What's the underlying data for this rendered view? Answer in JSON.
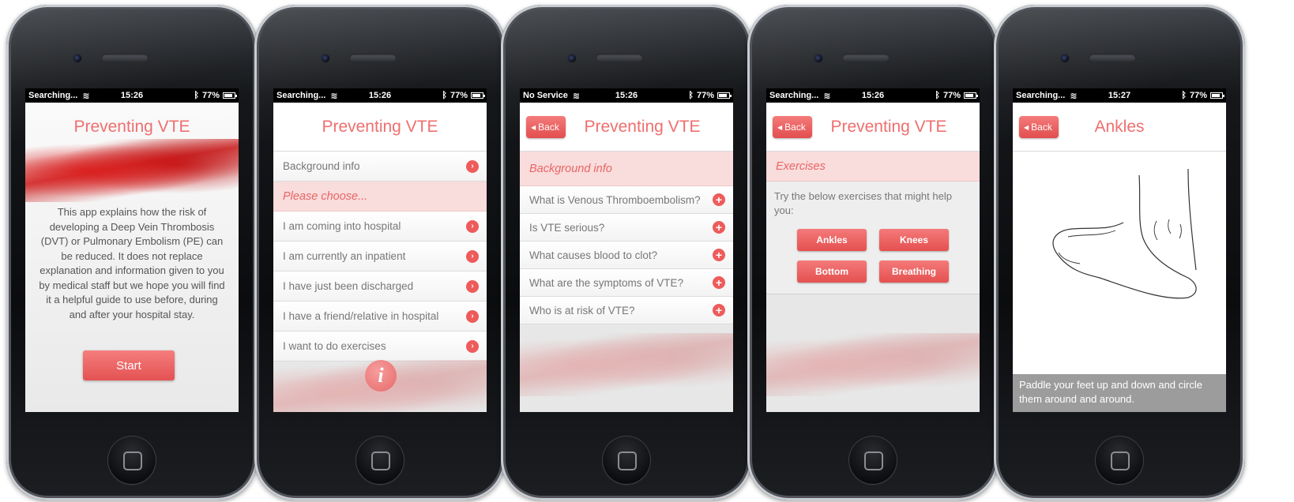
{
  "screens": [
    {
      "status": {
        "carrier": "Searching...",
        "time": "15:26",
        "battery": "77%"
      },
      "title": "Preventing VTE",
      "intro": "This app explains how the risk of developing a Deep Vein Thrombosis (DVT) or Pulmonary Embolism (PE) can be reduced. It does not replace explanation and information given to you by medical staff but we hope you will find it a helpful guide to use before, during and after your hospital stay.",
      "start_label": "Start"
    },
    {
      "status": {
        "carrier": "Searching...",
        "time": "15:26",
        "battery": "77%"
      },
      "title": "Preventing VTE",
      "background_item": "Background info",
      "section": "Please choose...",
      "items": [
        "I am coming into hospital",
        "I am currently an inpatient",
        "I have just been discharged",
        "I have a friend/relative in hospital",
        "I want to do exercises"
      ]
    },
    {
      "status": {
        "carrier": "No Service",
        "time": "15:26",
        "battery": "77%"
      },
      "back_label": "Back",
      "title": "Preventing VTE",
      "section": "Background info",
      "items": [
        "What is Venous Thromboembolism?",
        "Is VTE serious?",
        "What causes blood to clot?",
        "What are the symptoms of VTE?",
        "Who is at risk of VTE?"
      ]
    },
    {
      "status": {
        "carrier": "Searching...",
        "time": "15:26",
        "battery": "77%"
      },
      "back_label": "Back",
      "title": "Preventing VTE",
      "section": "Exercises",
      "text": "Try the below exercises that might help you:",
      "buttons": [
        "Ankles",
        "Knees",
        "Bottom",
        "Breathing"
      ]
    },
    {
      "status": {
        "carrier": "Searching...",
        "time": "15:27",
        "battery": "77%"
      },
      "back_label": "Back",
      "title": "Ankles",
      "caption": "Paddle your feet up and down and circle them around and around."
    }
  ],
  "colors": {
    "accent": "#ef6f6f",
    "button": "#e55050",
    "section_bg": "#f9dcdc"
  },
  "icons": {
    "wifi": "wifi-icon",
    "bluetooth": "bluetooth-icon",
    "battery": "battery-icon",
    "arrow": "chevron-right-circle-icon",
    "plus": "plus-circle-icon",
    "info": "info-icon"
  }
}
